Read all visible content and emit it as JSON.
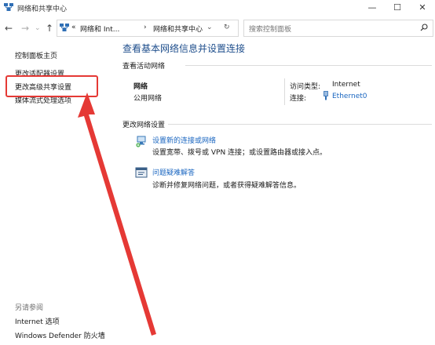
{
  "window": {
    "title": "网络和共享中心",
    "controls": {
      "minimize": "—",
      "maximize": "☐",
      "close": "✕"
    }
  },
  "nav": {
    "back": "←",
    "forward": "→",
    "up": "↑",
    "breadcrumbs": [
      "«",
      "网络和 Int...",
      "›",
      "网络和共享中心"
    ],
    "dropdown": "⌄",
    "refresh": "↻",
    "search_placeholder": "搜索控制面板"
  },
  "sidebar": {
    "home": "控制面板主页",
    "items": [
      "更改适配器设置",
      "更改高级共享设置",
      "媒体流式处理选项"
    ],
    "see_also_heading": "另请参阅",
    "see_also": [
      "Internet 选项",
      "Windows Defender 防火墙"
    ]
  },
  "main": {
    "title": "查看基本网络信息并设置连接",
    "active_heading": "查看活动网络",
    "network_name": "网络",
    "network_type": "公用网络",
    "access_label": "访问类型:",
    "access_value": "Internet",
    "connection_label": "连接:",
    "connection_value": "Ethernet0",
    "change_heading": "更改网络设置",
    "tasks": [
      {
        "title": "设置新的连接或网络",
        "desc": "设置宽带、拨号或 VPN 连接；或设置路由器或接入点。",
        "icon": "new-connection-icon"
      },
      {
        "title": "问题疑难解答",
        "desc": "诊断并修复网络问题，或者获得疑难解答信息。",
        "icon": "troubleshoot-icon"
      }
    ]
  },
  "annotation": {
    "highlight_color": "#e53935"
  }
}
